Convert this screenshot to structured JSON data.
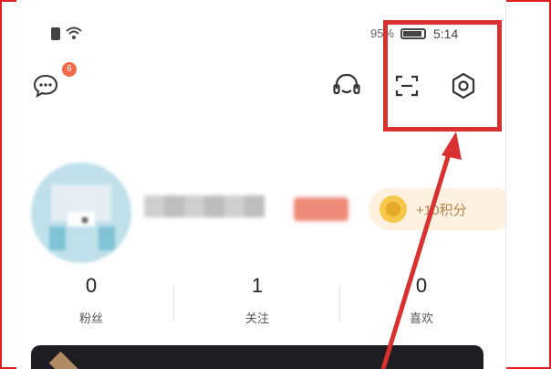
{
  "status_bar": {
    "battery_percent": "95%",
    "time": "5:14"
  },
  "header": {
    "message_badge_count": "6"
  },
  "profile": {
    "points_label": "+10积分"
  },
  "stats": [
    {
      "value": "0",
      "label": "粉丝"
    },
    {
      "value": "1",
      "label": "关注"
    },
    {
      "value": "0",
      "label": "喜欢"
    }
  ],
  "annotation": {
    "highlight_color": "#d93030"
  }
}
